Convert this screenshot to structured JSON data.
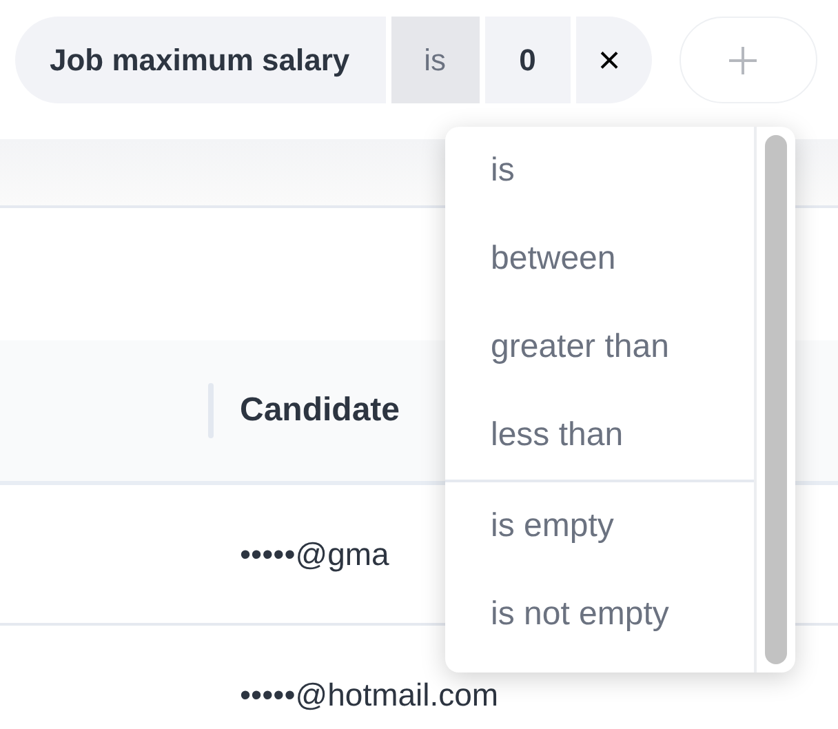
{
  "filter_chip": {
    "field": "Job maximum salary",
    "operator": {
      "label": "is",
      "open": true
    },
    "value": "0",
    "remove": "×"
  },
  "table": {
    "columns": [
      {
        "label": "Candidate"
      }
    ],
    "rows": [
      {
        "email": "•••••@gma"
      },
      {
        "email": "•••••@hotmail.com"
      }
    ]
  },
  "operator_menu": {
    "groups": [
      [
        {
          "label": "is"
        },
        {
          "label": "between"
        },
        {
          "label": "greater than"
        },
        {
          "label": "less than"
        }
      ],
      [
        {
          "label": "is empty"
        },
        {
          "label": "is not empty"
        }
      ]
    ]
  }
}
